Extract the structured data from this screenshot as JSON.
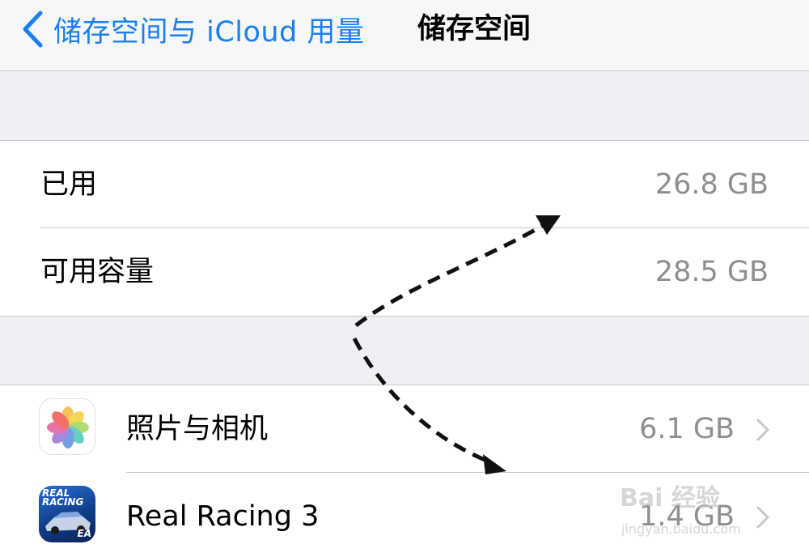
{
  "navbar": {
    "back_label": "储存空间与 iCloud 用量",
    "title": "储存空间"
  },
  "storage": {
    "used_label": "已用",
    "used_value": "26.8 GB",
    "available_label": "可用容量",
    "available_value": "28.5 GB"
  },
  "apps": [
    {
      "name": "照片与相机",
      "size": "6.1 GB",
      "icon": "photos-icon"
    },
    {
      "name": "Real Racing 3",
      "size": "1.4 GB",
      "icon": "real-racing-icon"
    }
  ],
  "racing_icon_text": {
    "line1": "REAL",
    "line2": "RACING",
    "badge": "EA"
  },
  "watermark": {
    "main": "Bai 经验",
    "sub": "jingyan.baidu.com"
  },
  "colors": {
    "accent": "#1a7ff0",
    "secondary_text": "#8e8e93",
    "background": "#efeff4"
  }
}
